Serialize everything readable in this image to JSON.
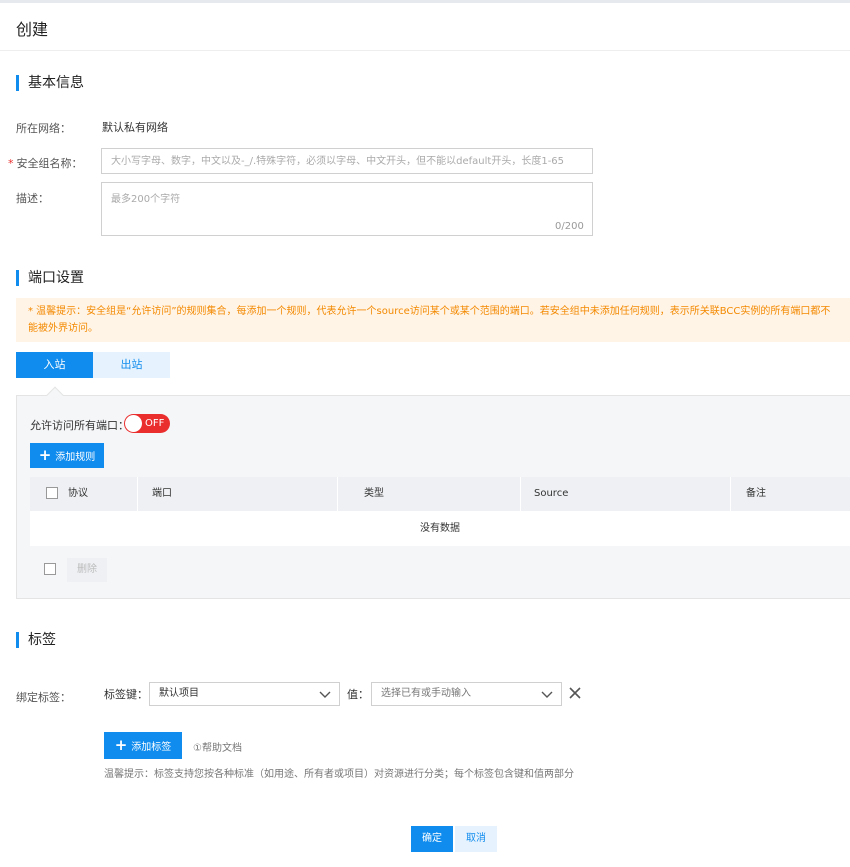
{
  "page": {
    "title": "创建"
  },
  "basic_info": {
    "title": "基本信息",
    "network_label": "所在网络：",
    "network_value": "默认私有网络",
    "name_required_mark": "*",
    "name_label": "安全组名称：",
    "name_placeholder": "大小写字母、数字，中文以及-_/.特殊字符，必须以字母、中文开头，但不能以default开头，长度1-65",
    "desc_label": "描述：",
    "desc_placeholder": "最多200个字符",
    "desc_counter": "0/200"
  },
  "port_settings": {
    "title": "端口设置",
    "warning_line1": "* 温馨提示：安全组是“允许访问”的规则集合，每添加一个规则，代表允许一个source访问某个或某个范围的端口。若安全组中未添加任何规则，表示所关联BCC实例的所有端口都不",
    "warning_line2": "能被外界访问。",
    "tabs": [
      {
        "label": "入站",
        "active": true
      },
      {
        "label": "出站",
        "active": false
      }
    ],
    "allow_all_label": "允许访问所有端口：",
    "allow_all_state": "OFF",
    "add_rule_label": "添加规则",
    "table": {
      "columns": [
        "协议",
        "端口",
        "类型",
        "Source",
        "备注"
      ],
      "empty_text": "没有数据"
    },
    "delete_label": "删除"
  },
  "tags": {
    "title": "标签",
    "bind_label": "绑定标签：",
    "key_label": "标签键：",
    "key_value": "默认项目",
    "value_label": "值：",
    "value_placeholder": "选择已有或手动输入",
    "add_tag_label": "添加标签",
    "help_label": "①帮助文档",
    "tip": "温馨提示：标签支持您按各种标准（如用途、所有者或项目）对资源进行分类；每个标签包含键和值两部分"
  },
  "footer": {
    "confirm_label": "确定",
    "cancel_label": "取消"
  },
  "colors": {
    "accent": "#108cee",
    "toggle_off": "#ea2e2e",
    "warning_text": "#f38900",
    "warning_bg": "#fff4e6"
  },
  "icons": [
    "plus-icon",
    "chevron-down-icon",
    "close-icon"
  ]
}
